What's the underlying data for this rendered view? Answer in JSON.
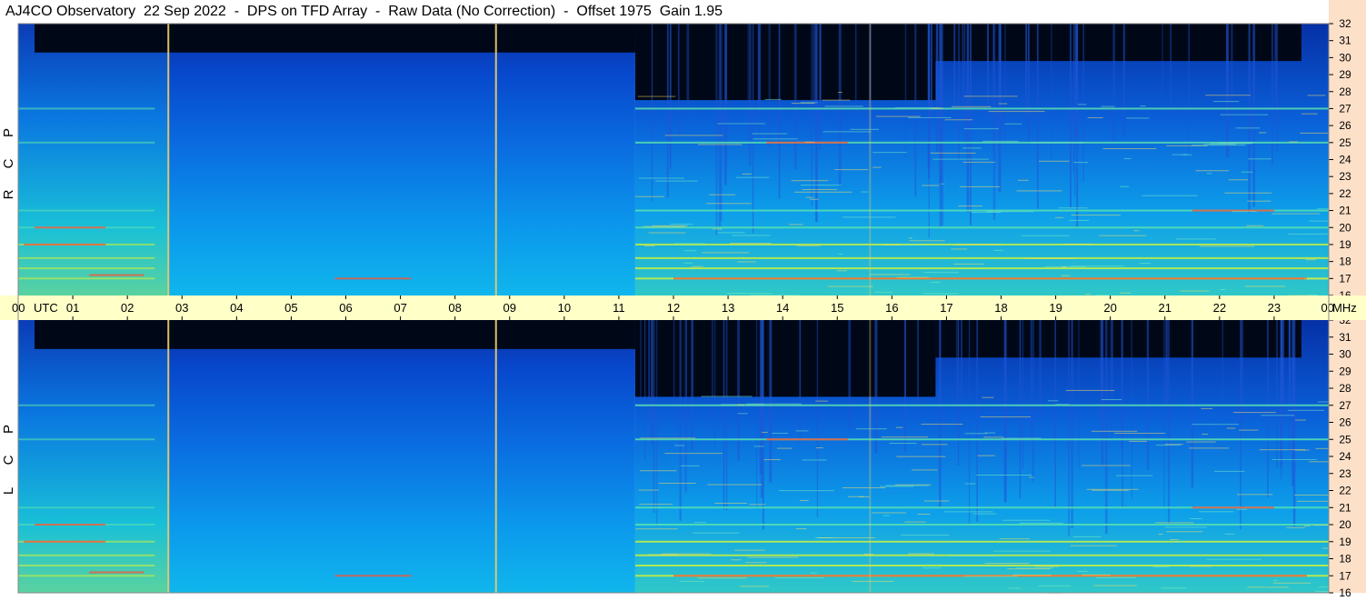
{
  "title": "AJ4CO Observatory  22 Sep 2022  -  DPS on TFD Array  -  Raw Data (No Correction)  -  Offset 1975  Gain 1.95",
  "colors": {
    "time_axis_band": "#ffffc8",
    "freq_axis_band": "#fde0c8",
    "night_sky_dark": "#000818",
    "marker_line": "#e8c86a"
  },
  "chart_data": {
    "type": "heatmap",
    "x_axis": {
      "ticks": [
        "00",
        "01",
        "02",
        "03",
        "04",
        "05",
        "06",
        "07",
        "08",
        "09",
        "10",
        "11",
        "12",
        "13",
        "14",
        "15",
        "16",
        "17",
        "18",
        "19",
        "20",
        "21",
        "22",
        "23",
        "00"
      ],
      "unit_label": "UTC",
      "end_unit": "MHz",
      "range_hours": [
        0,
        24
      ]
    },
    "y_axis": {
      "ticks": [
        16,
        17,
        18,
        19,
        20,
        21,
        22,
        23,
        24,
        25,
        26,
        27,
        28,
        29,
        30,
        31,
        32
      ],
      "range_mhz": [
        16,
        32
      ]
    },
    "panels": [
      {
        "name": "RCP",
        "letters": [
          "P",
          "C",
          "R"
        ]
      },
      {
        "name": "LCP",
        "letters": [
          "P",
          "C",
          "L"
        ]
      }
    ],
    "vertical_markers_utc": [
      2.75,
      8.75,
      15.6
    ],
    "dark_top_mhz": {
      "before_11_3": 30.3,
      "after_11_3": 27.5
    },
    "bright_lines_mhz": [
      17.0,
      17.6,
      18.2,
      19.0,
      20.0,
      21.0,
      25.0,
      27.0
    ]
  }
}
